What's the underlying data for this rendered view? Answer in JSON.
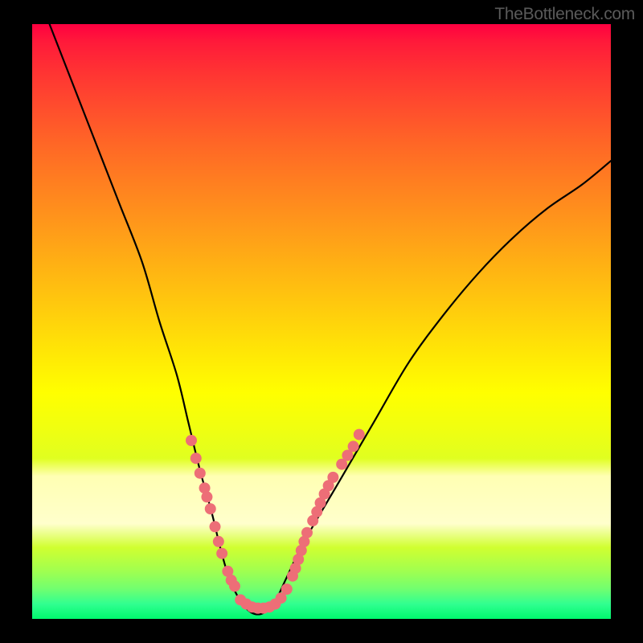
{
  "watermark": "TheBottleneck.com",
  "colors": {
    "background": "#000000",
    "curve_stroke": "#000000",
    "dots_fill": "#ed6e77",
    "gradient_top": "#ff0040",
    "gradient_bottom": "#00f86e"
  },
  "chart_data": {
    "type": "line",
    "title": "",
    "xlabel": "",
    "ylabel": "",
    "xlim": [
      0,
      100
    ],
    "ylim": [
      0,
      100
    ],
    "grid": false,
    "series": [
      {
        "name": "bottleneck-curve",
        "x": [
          3,
          7,
          11,
          15,
          19,
          22,
          25,
          27,
          29,
          31,
          32.5,
          34,
          36,
          38,
          40,
          42,
          44,
          47,
          53,
          59,
          65,
          71,
          77,
          83,
          89,
          95,
          100
        ],
        "values": [
          100,
          90,
          80,
          70,
          60,
          50,
          41,
          33,
          25,
          18,
          12,
          7,
          3,
          1,
          1,
          3,
          7,
          13,
          23,
          33,
          43,
          51,
          58,
          64,
          69,
          73,
          77
        ]
      }
    ],
    "dot_clusters": [
      {
        "name": "left-branch-dots",
        "points": [
          {
            "x": 27.5,
            "y": 30
          },
          {
            "x": 28.3,
            "y": 27
          },
          {
            "x": 29.0,
            "y": 24.5
          },
          {
            "x": 29.8,
            "y": 22
          },
          {
            "x": 30.2,
            "y": 20.5
          },
          {
            "x": 30.8,
            "y": 18.5
          },
          {
            "x": 31.6,
            "y": 15.5
          },
          {
            "x": 32.2,
            "y": 13
          },
          {
            "x": 32.8,
            "y": 11
          },
          {
            "x": 33.8,
            "y": 8
          },
          {
            "x": 34.4,
            "y": 6.5
          },
          {
            "x": 35.0,
            "y": 5.5
          }
        ]
      },
      {
        "name": "trough-dots",
        "points": [
          {
            "x": 36.0,
            "y": 3.2
          },
          {
            "x": 37.0,
            "y": 2.5
          },
          {
            "x": 38.0,
            "y": 2.0
          },
          {
            "x": 39.0,
            "y": 1.8
          },
          {
            "x": 40.0,
            "y": 1.8
          },
          {
            "x": 41.0,
            "y": 2.0
          },
          {
            "x": 42.0,
            "y": 2.5
          },
          {
            "x": 43.0,
            "y": 3.5
          },
          {
            "x": 44.0,
            "y": 5.0
          }
        ]
      },
      {
        "name": "right-branch-dots",
        "points": [
          {
            "x": 45.0,
            "y": 7.2
          },
          {
            "x": 45.5,
            "y": 8.5
          },
          {
            "x": 46.0,
            "y": 10
          },
          {
            "x": 46.5,
            "y": 11.5
          },
          {
            "x": 47.0,
            "y": 13
          },
          {
            "x": 47.5,
            "y": 14.5
          },
          {
            "x": 48.5,
            "y": 16.5
          },
          {
            "x": 49.2,
            "y": 18
          },
          {
            "x": 49.8,
            "y": 19.5
          },
          {
            "x": 50.5,
            "y": 21
          },
          {
            "x": 51.2,
            "y": 22.4
          },
          {
            "x": 52.0,
            "y": 23.8
          },
          {
            "x": 53.5,
            "y": 26
          },
          {
            "x": 54.5,
            "y": 27.5
          },
          {
            "x": 55.5,
            "y": 29
          },
          {
            "x": 56.5,
            "y": 31
          }
        ]
      }
    ]
  }
}
